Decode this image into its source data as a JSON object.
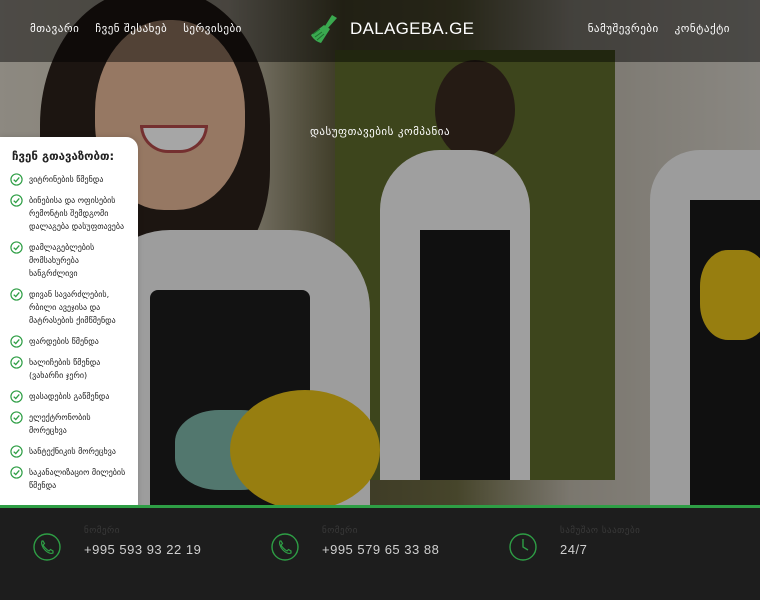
{
  "header": {
    "nav_left": [
      "მთავარი",
      "ჩვენ შესახებ",
      "სერვისები"
    ],
    "logo_text": "DALAGEBA.GE",
    "logo_icon": "broom-icon",
    "nav_right": [
      "ნამუშევრები",
      "კონტაქტი"
    ]
  },
  "hero": {
    "tagline": "დასუფთავების კომპანია"
  },
  "services": {
    "title": "ჩვენ გთავაზობთ:",
    "items": [
      "ვიტრინების წმენდა",
      "ბინებისა და ოფისების რემონტის შემდგომი დალაგება დასუფთავება",
      "დამლაგებლების მომსახურება ხანგრძლივი",
      "დივან სავარძლების, რბილი ავეჯისა და მატრასების ქიმწმენდა",
      "ფარდების წმენდა",
      "ხალიჩების წმენდა (ვახარჩი ჯერი)",
      "ფასადების გაწმენდა",
      "ელექტრონობის მორეცხვა",
      "სანტექნიკის მორეცხვა",
      "საკანალიზაციო მილების წმენდა"
    ],
    "accent_color": "#2e9e45"
  },
  "footer": {
    "contacts": [
      {
        "icon": "phone-icon",
        "label": "ნომერი",
        "value": "+995 593 93 22 19"
      },
      {
        "icon": "phone-icon",
        "label": "ნომერი",
        "value": "+995 579 65 33 88"
      },
      {
        "icon": "clock-icon",
        "label": "სამუშაო საათები",
        "value": "24/7"
      }
    ],
    "accent_color": "#2e9e45"
  }
}
